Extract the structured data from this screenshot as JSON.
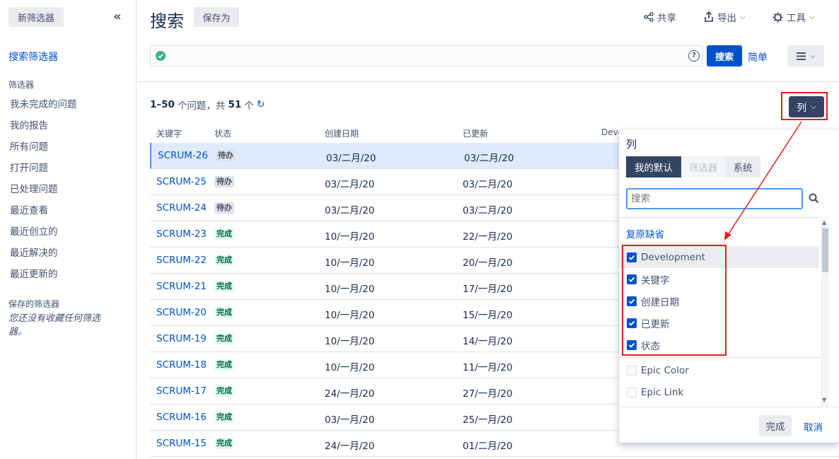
{
  "sidebar": {
    "new_filter": "新筛选器",
    "search_filters": "搜索筛选器",
    "filters_heading": "筛选器",
    "filters": [
      "我未完成的问题",
      "我的报告",
      "所有问题",
      "打开问题",
      "已处理问题",
      "最近查看",
      "最近创立的",
      "最近解决的",
      "最近更新的"
    ],
    "saved_heading": "保存的筛选器",
    "saved_empty": "您还没有收藏任何筛选器。"
  },
  "header": {
    "title": "搜索",
    "save_as": "保存为",
    "share": "共享",
    "export": "导出",
    "tools": "工具"
  },
  "jql": {
    "search_button": "搜索",
    "simple_link": "简单"
  },
  "results": {
    "range": "1–50",
    "text_issues": "个问题，共",
    "total": "51",
    "text_unit": "个"
  },
  "columns_button": "列",
  "table": {
    "headers": [
      "关键字",
      "状态",
      "创建日期",
      "已更新",
      "Deve"
    ],
    "rows": [
      {
        "key": "SCRUM-26",
        "status": "待办",
        "status_type": "todo",
        "created": "03/二月/20",
        "updated": "03/二月/20"
      },
      {
        "key": "SCRUM-25",
        "status": "待办",
        "status_type": "todo",
        "created": "03/二月/20",
        "updated": "03/二月/20"
      },
      {
        "key": "SCRUM-24",
        "status": "待办",
        "status_type": "todo",
        "created": "03/二月/20",
        "updated": "03/二月/20"
      },
      {
        "key": "SCRUM-23",
        "status": "完成",
        "status_type": "done",
        "created": "10/一月/20",
        "updated": "22/一月/20"
      },
      {
        "key": "SCRUM-22",
        "status": "完成",
        "status_type": "done",
        "created": "10/一月/20",
        "updated": "20/一月/20"
      },
      {
        "key": "SCRUM-21",
        "status": "完成",
        "status_type": "done",
        "created": "10/一月/20",
        "updated": "17/一月/20"
      },
      {
        "key": "SCRUM-20",
        "status": "完成",
        "status_type": "done",
        "created": "10/一月/20",
        "updated": "15/一月/20"
      },
      {
        "key": "SCRUM-19",
        "status": "完成",
        "status_type": "done",
        "created": "10/一月/20",
        "updated": "14/一月/20"
      },
      {
        "key": "SCRUM-18",
        "status": "完成",
        "status_type": "done",
        "created": "10/一月/20",
        "updated": "11/一月/20"
      },
      {
        "key": "SCRUM-17",
        "status": "完成",
        "status_type": "done",
        "created": "24/一月/20",
        "updated": "27/一月/20"
      },
      {
        "key": "SCRUM-16",
        "status": "完成",
        "status_type": "done",
        "created": "03/一月/20",
        "updated": "25/一月/20"
      },
      {
        "key": "SCRUM-15",
        "status": "完成",
        "status_type": "done",
        "created": "24/一月/20",
        "updated": "01/二月/20"
      }
    ]
  },
  "picker": {
    "title": "列",
    "tabs": [
      "我的默认",
      "筛选器",
      "系统"
    ],
    "search_placeholder": "搜索",
    "restore_default": "复原缺省",
    "items": [
      {
        "label": "Development",
        "checked": true
      },
      {
        "label": "关键字",
        "checked": true
      },
      {
        "label": "创建日期",
        "checked": true
      },
      {
        "label": "已更新",
        "checked": true
      },
      {
        "label": "状态",
        "checked": true
      },
      {
        "label": "Epic Color",
        "checked": false
      },
      {
        "label": "Epic Link",
        "checked": false
      }
    ],
    "done": "完成",
    "cancel": "取消"
  },
  "colors": {
    "primary": "#0052cc",
    "dark_button": "#344563",
    "annotation": "#e0201b",
    "done_lozenge_bg": "#e3fcef",
    "done_lozenge_text": "#006644"
  }
}
